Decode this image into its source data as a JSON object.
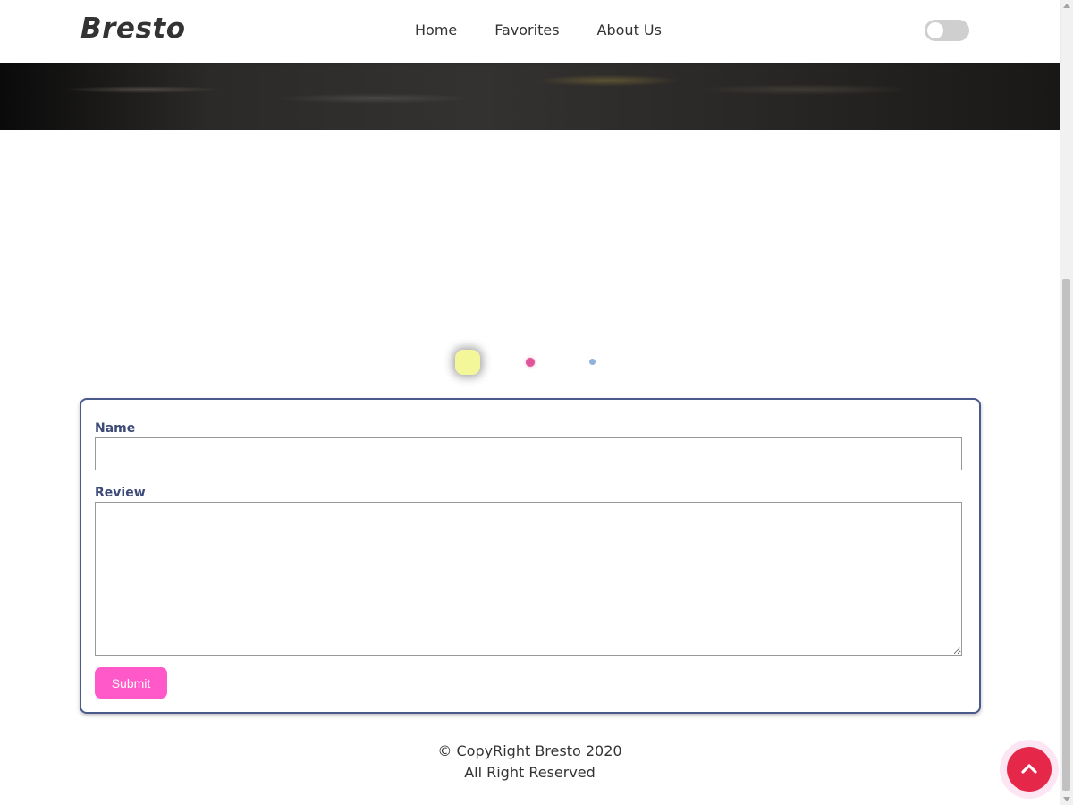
{
  "header": {
    "logo": "Bresto",
    "nav": [
      "Home",
      "Favorites",
      "About Us"
    ],
    "theme_toggle_on": false
  },
  "carousel": {
    "indicators": 3,
    "active_index": 0,
    "colors": [
      "#f4f69a",
      "#e0559a",
      "#8fb1dc"
    ]
  },
  "form": {
    "name_label": "Name",
    "name_value": "",
    "review_label": "Review",
    "review_value": "",
    "submit_label": "Submit",
    "border_color": "#4a5a8c",
    "submit_color": "#ff58c8"
  },
  "footer": {
    "copyright": "© CopyRight Bresto 2020",
    "rights": "All Right Reserved"
  },
  "back_to_top": {
    "icon": "chevron-up-icon",
    "color": "#e5284a"
  }
}
